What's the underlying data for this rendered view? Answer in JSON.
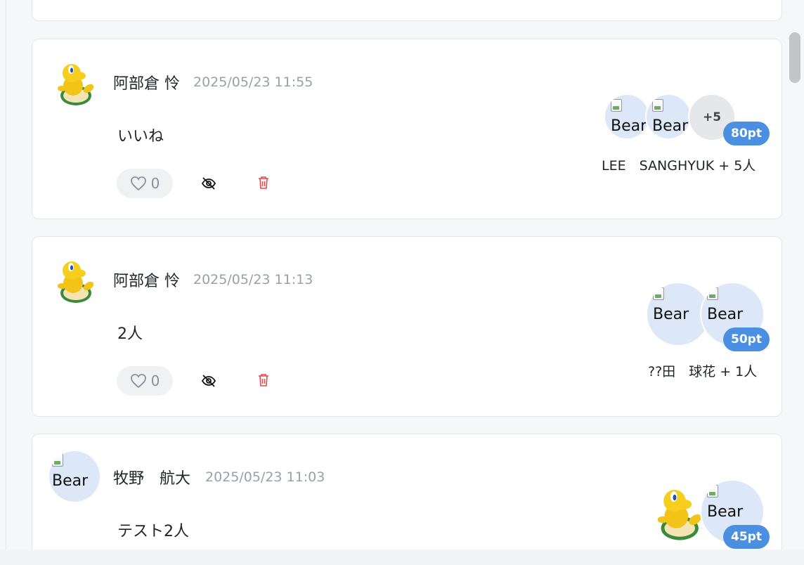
{
  "posts": [
    {
      "author": "阿部倉 怜",
      "timestamp": "2025/05/23 11:55",
      "message": "いいね",
      "likes": "0",
      "recipients_more": "+5",
      "points": "80pt",
      "recipients_label": "LEE　SANGHYUK + 5人",
      "recipient_alt": "Bear"
    },
    {
      "author": "阿部倉 怜",
      "timestamp": "2025/05/23 11:13",
      "message": "2人",
      "likes": "0",
      "points": "50pt",
      "recipients_label": "??田　球花 + 1人",
      "recipient_alt": "Bear"
    },
    {
      "author": "牧野　航大",
      "timestamp": "2025/05/23 11:03",
      "message": "テスト2人",
      "points": "45pt",
      "avatar_alt": "Bear",
      "recipient_alt": "Bear"
    }
  ],
  "colors": {
    "accent": "#4a8fe2",
    "delete": "#e5484d",
    "muted": "#9aa0a8"
  },
  "icons": [
    "heart-icon",
    "eye-off-icon",
    "trash-icon",
    "koopa-avatar-image",
    "broken-image-icon"
  ]
}
